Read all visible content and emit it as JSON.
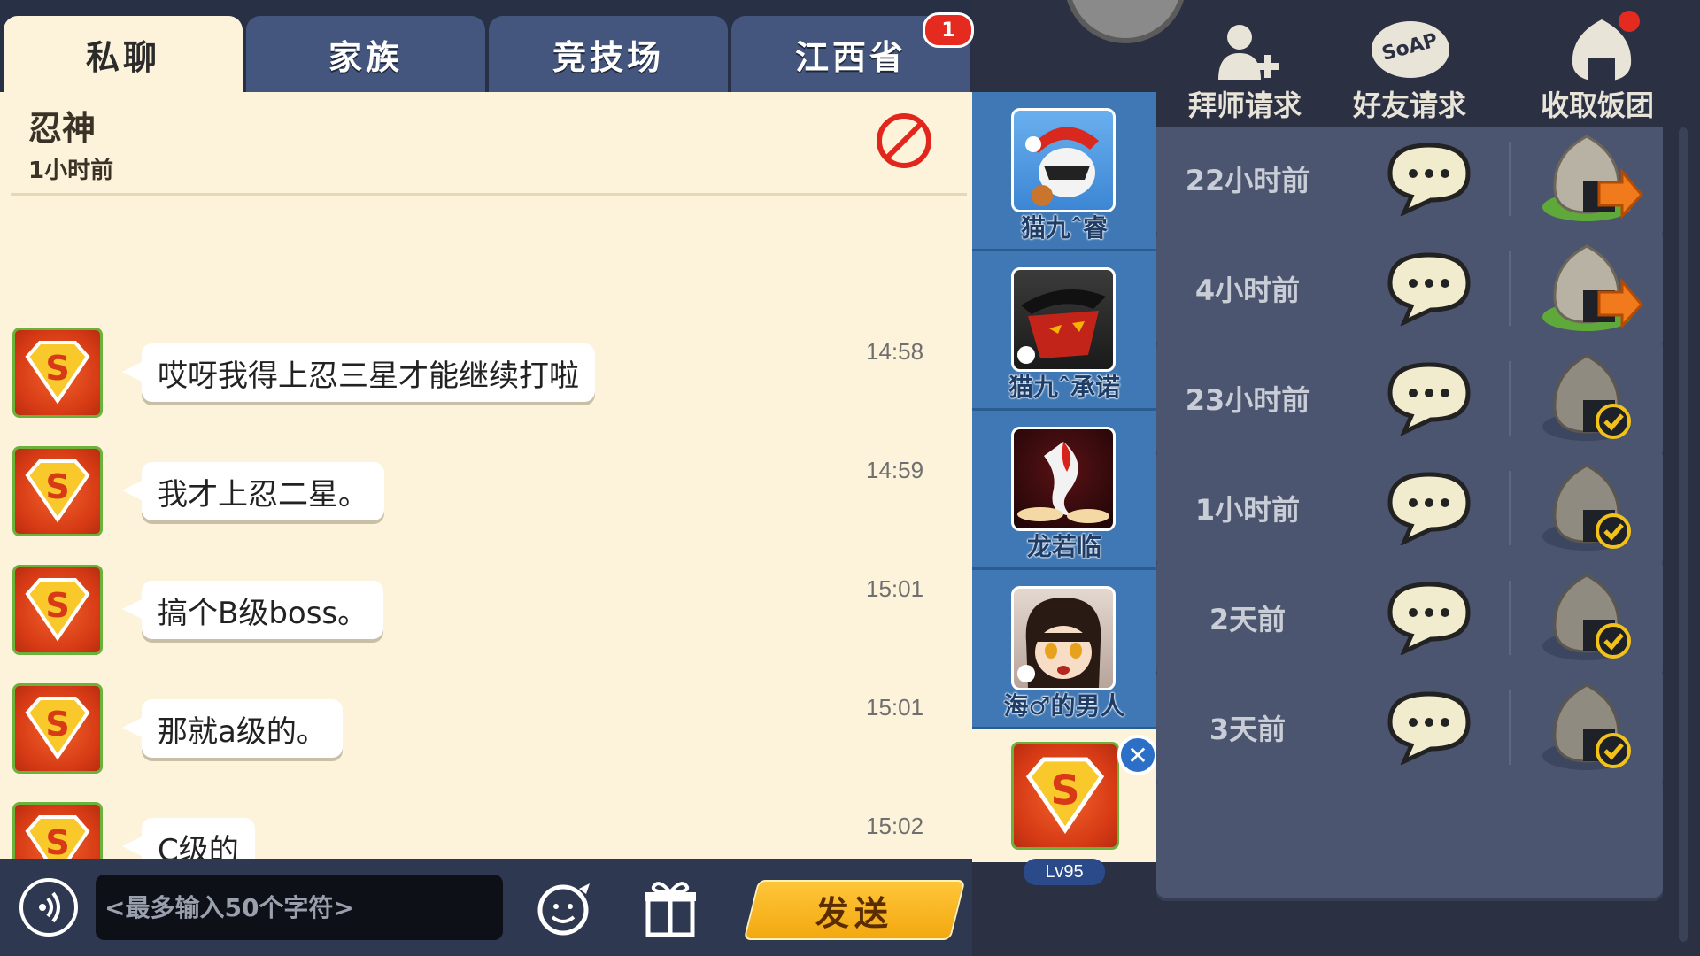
{
  "tabs": [
    {
      "label": "私聊",
      "active": true
    },
    {
      "label": "家族",
      "active": false
    },
    {
      "label": "竞技场",
      "active": false
    },
    {
      "label": "江西省",
      "active": false,
      "badge": "1"
    }
  ],
  "chat": {
    "contact_name": "忍神",
    "contact_last_seen": "1小时前",
    "messages": [
      {
        "text": "哎呀我得上忍三星才能继续打啦",
        "time": "14:58"
      },
      {
        "text": "我才上忍二星。",
        "time": "14:59"
      },
      {
        "text": "搞个B级boss。",
        "time": "15:01"
      },
      {
        "text": "那就a级的。",
        "time": "15:01"
      },
      {
        "text": "C级的",
        "time": "15:02"
      }
    ]
  },
  "input": {
    "placeholder": "<最多输入50个字符>",
    "send_label": "发送"
  },
  "contacts": [
    {
      "name": "猫九ˆ睿",
      "icon": "santa-ninja-avatar"
    },
    {
      "name": "猫九ˆ承诺",
      "icon": "masked-ninja-avatar"
    },
    {
      "name": "龙若临",
      "icon": "koi-avatar"
    },
    {
      "name": "海♂的男人",
      "icon": "ninja-girl-avatar"
    },
    {
      "name": "",
      "icon": "superman-avatar",
      "selected": true,
      "level": "Lv95"
    }
  ],
  "right_panel": {
    "top_buttons": [
      {
        "label": "拜师请求",
        "icon": "add-mentor-icon"
      },
      {
        "label": "好友请求",
        "icon": "soap-icon"
      },
      {
        "label": "收取饭团",
        "icon": "rice-ball-icon"
      }
    ],
    "friends": [
      {
        "time": "22小时前",
        "rice_state": "send"
      },
      {
        "time": "4小时前",
        "rice_state": "send"
      },
      {
        "time": "23小时前",
        "rice_state": "done"
      },
      {
        "time": "1小时前",
        "rice_state": "done"
      },
      {
        "time": "2天前",
        "rice_state": "done"
      },
      {
        "time": "3天前",
        "rice_state": "done"
      }
    ]
  },
  "colors": {
    "chat_bg": "#fcf3da",
    "tab_inactive": "#44567e",
    "contact_list_bg": "#3f78b5",
    "send_button": "#f3a810",
    "badge_red": "#e52b1f"
  }
}
